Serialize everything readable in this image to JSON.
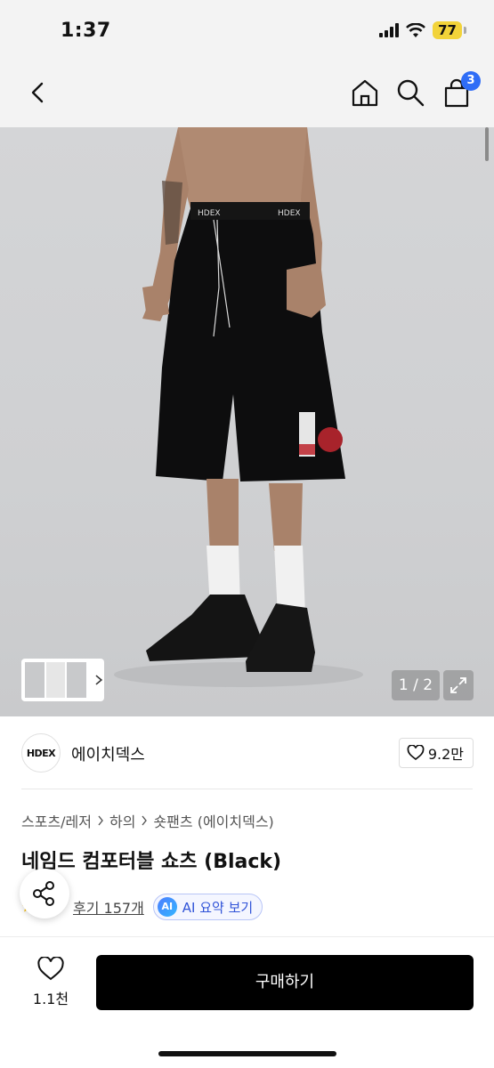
{
  "status_bar": {
    "time": "1:37",
    "battery": "77"
  },
  "nav": {
    "cart_count": "3"
  },
  "gallery": {
    "waistband_text_1": "HDEX",
    "waistband_text_2": "HDEX",
    "page_indicator": "1 / 2"
  },
  "brand": {
    "logo_text": "HDEX",
    "name": "에이치덱스",
    "likes": "9.2만"
  },
  "breadcrumb": [
    "스포츠/레저",
    "하의",
    "숏팬츠 (에이치덱스)"
  ],
  "product": {
    "title": "네임드 컴포터블 쇼츠 (Black)"
  },
  "reviews": {
    "link_label": "후기 157개",
    "ai_badge": "AI",
    "ai_label": "AI 요약 보기"
  },
  "bottom": {
    "wish_count": "1.1천",
    "buy_label": "구매하기"
  },
  "colors": {
    "accent_blue": "#2f6df6",
    "buy_button": "#000000",
    "ai_text": "#3154d8"
  },
  "icons": [
    "back-icon",
    "home-icon",
    "search-icon",
    "cart-icon",
    "chevron-right-icon",
    "expand-icon",
    "heart-icon",
    "share-icon",
    "star-icon"
  ]
}
